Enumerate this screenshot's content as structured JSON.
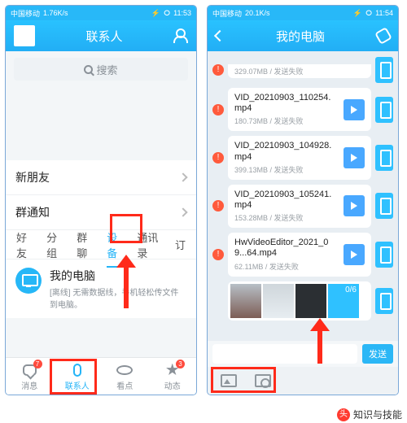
{
  "left": {
    "status": {
      "net": "1.76K/s",
      "time": "11:53"
    },
    "header": {
      "title": "联系人"
    },
    "search": {
      "placeholder": "搜索"
    },
    "rows": {
      "new_friends": "新朋友",
      "group_notice": "群通知"
    },
    "tabs": [
      "好友",
      "分组",
      "群聊",
      "设备",
      "通讯录",
      "订"
    ],
    "active_tab_index": 3,
    "device": {
      "title": "我的电脑",
      "subtitle": "[离线] 无需数据线，手机轻松传文件到电脑。"
    },
    "nav": [
      {
        "label": "消息",
        "badge": "7"
      },
      {
        "label": "联系人",
        "badge": ""
      },
      {
        "label": "看点",
        "badge": ""
      },
      {
        "label": "动态",
        "badge": "3"
      }
    ],
    "active_nav_index": 1
  },
  "right": {
    "status": {
      "net": "20.1K/s",
      "time": "11:54"
    },
    "header": {
      "title": "我的电脑"
    },
    "truncated_meta": "329.07MB / 发送失败",
    "files": [
      {
        "name": "VID_20210903_110254.mp4",
        "meta": "180.73MB / 发送失败"
      },
      {
        "name": "VID_20210903_104928.mp4",
        "meta": "399.13MB / 发送失败"
      },
      {
        "name": "VID_20210903_105241.mp4",
        "meta": "153.28MB / 发送失败"
      },
      {
        "name": "HwVideoEditor_2021_09...64.mp4",
        "meta": "62.11MB / 发送失败"
      }
    ],
    "image_msg": {
      "more": "0/6"
    },
    "send_label": "发送"
  },
  "watermark": "知识与技能"
}
